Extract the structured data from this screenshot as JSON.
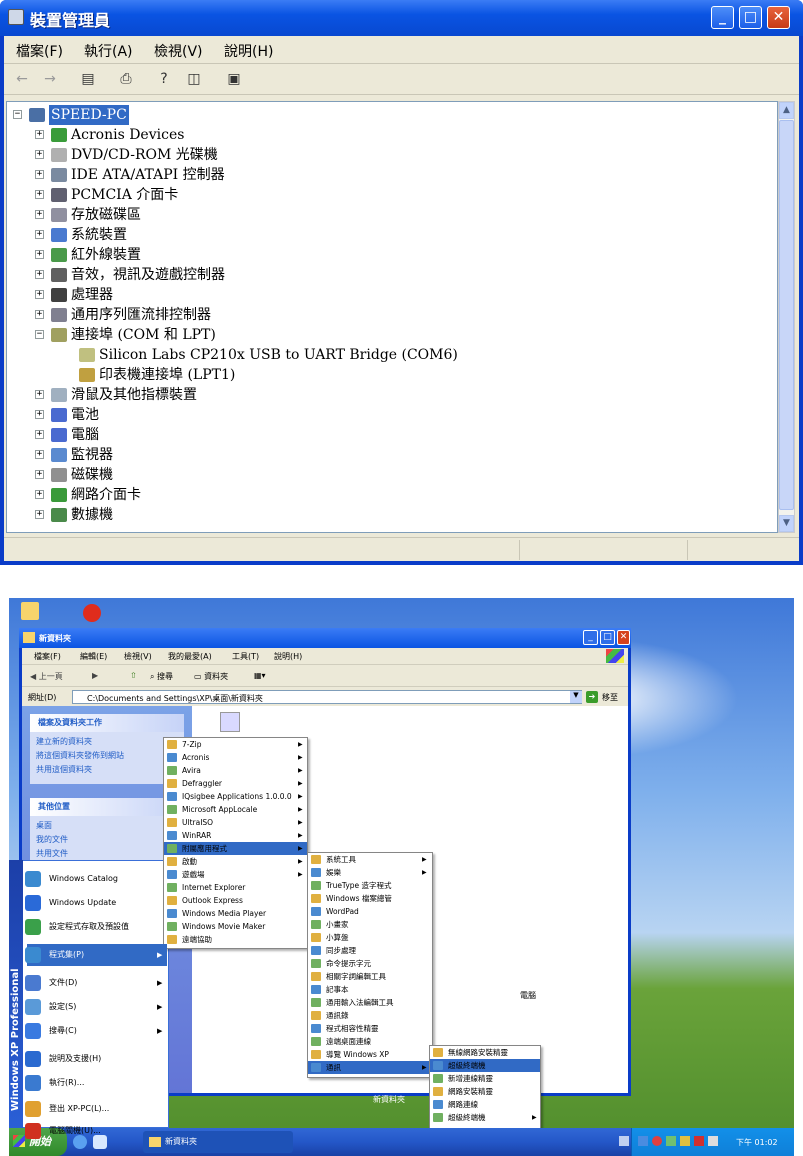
{
  "device_manager": {
    "title": "裝置管理員",
    "menu": [
      "檔案(F)",
      "執行(A)",
      "檢視(V)",
      "說明(H)"
    ],
    "tree": [
      {
        "label": "SPEED-PC",
        "level": 0,
        "expander": "−",
        "selected": true
      },
      {
        "label": "Acronis Devices",
        "level": 1,
        "expander": "+"
      },
      {
        "label": "DVD/CD-ROM 光碟機",
        "level": 1,
        "expander": "+"
      },
      {
        "label": "IDE ATA/ATAPI 控制器",
        "level": 1,
        "expander": "+"
      },
      {
        "label": "PCMCIA 介面卡",
        "level": 1,
        "expander": "+"
      },
      {
        "label": "存放磁碟區",
        "level": 1,
        "expander": "+"
      },
      {
        "label": "系統裝置",
        "level": 1,
        "expander": "+"
      },
      {
        "label": "紅外線裝置",
        "level": 1,
        "expander": "+"
      },
      {
        "label": "音效，視訊及遊戲控制器",
        "level": 1,
        "expander": "+"
      },
      {
        "label": "處理器",
        "level": 1,
        "expander": "+"
      },
      {
        "label": "通用序列匯流排控制器",
        "level": 1,
        "expander": "+"
      },
      {
        "label": "連接埠 (COM 和 LPT)",
        "level": 1,
        "expander": "−"
      },
      {
        "label": "Silicon Labs CP210x USB to UART Bridge (COM6)",
        "level": 2,
        "expander": ""
      },
      {
        "label": "印表機連接埠 (LPT1)",
        "level": 2,
        "expander": ""
      },
      {
        "label": "滑鼠及其他指標裝置",
        "level": 1,
        "expander": "+"
      },
      {
        "label": "電池",
        "level": 1,
        "expander": "+"
      },
      {
        "label": "電腦",
        "level": 1,
        "expander": "+"
      },
      {
        "label": "監視器",
        "level": 1,
        "expander": "+"
      },
      {
        "label": "磁碟機",
        "level": 1,
        "expander": "+"
      },
      {
        "label": "網路介面卡",
        "level": 1,
        "expander": "+"
      },
      {
        "label": "數據機",
        "level": 1,
        "expander": "+"
      }
    ],
    "colors": {
      "title_bar": "#0a54e3",
      "selection": "#316ac5",
      "face": "#ece9d8"
    }
  },
  "explorer": {
    "title": "新資料夾",
    "menu": [
      "檔案(F)",
      "編輯(E)",
      "檢視(V)",
      "我的最愛(A)",
      "工具(T)",
      "說明(H)"
    ],
    "toolbar": {
      "back": "上一頁",
      "search": "搜尋",
      "folders": "資料夾"
    },
    "address_label": "網址(D)",
    "address": "C:\\Documents and Settings\\XP\\桌面\\新資料夾",
    "go": "移至",
    "tasks_head": "檔案及資料夾工作",
    "tasks": [
      "建立新的資料夾",
      "將這個資料夾發佈到網站",
      "共用這個資料夾"
    ],
    "places_head": "其他位置",
    "places": [
      "桌面",
      "我的文件",
      "共用文件"
    ],
    "desktop_label": "新資料夾",
    "my_computer_fragment": "電腦"
  },
  "start_menu": {
    "items": [
      {
        "label": "Windows Catalog"
      },
      {
        "label": "Windows Update"
      },
      {
        "label": "設定程式存取及預設值"
      },
      {
        "label": "程式集(P)",
        "arrow": true,
        "highlighted": true
      },
      {
        "label": "文件(D)",
        "arrow": true
      },
      {
        "label": "設定(S)",
        "arrow": true
      },
      {
        "label": "搜尋(C)",
        "arrow": true
      },
      {
        "label": "說明及支援(H)"
      },
      {
        "label": "執行(R)..."
      },
      {
        "label": "登出 XP-PC(L)..."
      },
      {
        "label": "電腦關機(U)..."
      }
    ],
    "strip": "Windows XP Professional"
  },
  "programs_menu": [
    {
      "label": "7-Zip",
      "arrow": true
    },
    {
      "label": "Acronis",
      "arrow": true
    },
    {
      "label": "Avira",
      "arrow": true
    },
    {
      "label": "Defraggler",
      "arrow": true
    },
    {
      "label": "IQsigbee Applications 1.0.0.0",
      "arrow": true
    },
    {
      "label": "Microsoft AppLocale",
      "arrow": true
    },
    {
      "label": "UltraISO",
      "arrow": true
    },
    {
      "label": "WinRAR",
      "arrow": true
    },
    {
      "label": "附屬應用程式",
      "arrow": true,
      "highlighted": true
    },
    {
      "label": "啟動",
      "arrow": true
    },
    {
      "label": "遊戲場",
      "arrow": true
    },
    {
      "label": "Internet Explorer"
    },
    {
      "label": "Outlook Express"
    },
    {
      "label": "Windows Media Player"
    },
    {
      "label": "Windows Movie Maker"
    },
    {
      "label": "遠端協助"
    }
  ],
  "accessories_menu": [
    {
      "label": "系統工具",
      "arrow": true
    },
    {
      "label": "娛樂",
      "arrow": true
    },
    {
      "label": "TrueType 造字程式"
    },
    {
      "label": "Windows 檔案總管"
    },
    {
      "label": "WordPad"
    },
    {
      "label": "小畫家"
    },
    {
      "label": "小算盤"
    },
    {
      "label": "同步處理"
    },
    {
      "label": "命令提示字元"
    },
    {
      "label": "相關字詞編輯工具"
    },
    {
      "label": "記事本"
    },
    {
      "label": "通用輸入法編輯工具"
    },
    {
      "label": "通訊錄"
    },
    {
      "label": "程式相容性精靈"
    },
    {
      "label": "遠端桌面連線"
    },
    {
      "label": "導覽 Windows XP"
    },
    {
      "label": "通訊",
      "arrow": true,
      "highlighted": true
    }
  ],
  "comms_menu": [
    {
      "label": "無線網路安裝精靈"
    },
    {
      "label": "超級終端機",
      "highlighted": true
    },
    {
      "label": "新增連線精靈"
    },
    {
      "label": "網路安裝精靈"
    },
    {
      "label": "網路連線"
    },
    {
      "label": "超級終端機",
      "arrow": true
    }
  ],
  "taskbar": {
    "start": "開始",
    "task": "新資料夾",
    "clock": "下午 01:02"
  }
}
